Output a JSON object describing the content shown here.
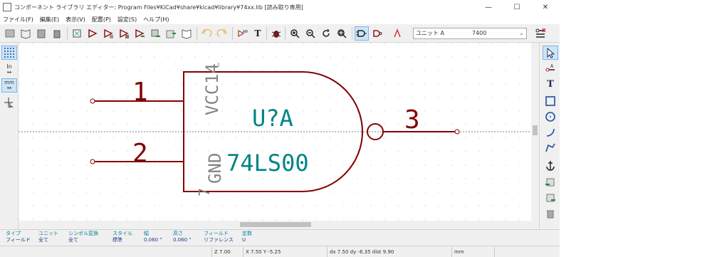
{
  "window": {
    "title": "コンポーネント ライブラリ エディター: Program Files¥KiCad¥share¥kicad¥library¥74xx.lib [読み取り専用]",
    "controls": [
      "—",
      "☐",
      "✕"
    ]
  },
  "menu": [
    "ファイル(F)",
    "編集(E)",
    "表示(V)",
    "配置(P)",
    "設定(S)",
    "ヘルプ(H)"
  ],
  "toolbar": {
    "part_combo": "ユニット A",
    "alias_combo": "7400"
  },
  "symbol": {
    "reference": "U?A",
    "value": "74LS00",
    "pin1": "1",
    "pin2": "2",
    "pin3": "3",
    "pin7": "7",
    "pin14": "14",
    "vcc": "VCC",
    "gnd": "GND"
  },
  "colors": {
    "body": "#840000",
    "pin_text": "#840000",
    "field": "#008484",
    "pin_name": "#848484"
  },
  "msgpanel": [
    {
      "h": "タイプ",
      "v": "フィールド"
    },
    {
      "h": "ユニット",
      "v": "全て"
    },
    {
      "h": "シンボル変換",
      "v": "全て"
    },
    {
      "h": "スタイル",
      "v": "標準"
    },
    {
      "h": "幅",
      "v": "0.060 \""
    },
    {
      "h": "高さ",
      "v": "0.060 \""
    },
    {
      "h": "フィールド",
      "v": "リファレンス"
    },
    {
      "h": "定数",
      "v": "U"
    }
  ],
  "status": {
    "zoom": "Z 7.00",
    "xy": "X 7.50  Y -5.25",
    "delta": "dx 7.50  dy -6.35  dist 9.90",
    "units": "mm"
  }
}
